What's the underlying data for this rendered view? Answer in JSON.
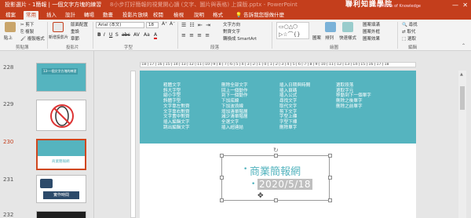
{
  "titlebar": {
    "left": "投影選片 - 1簡報 | 一個文字方塊的練習",
    "ghost": "8小步打好簡報的視覺開心讀 (文字、圖片與表格) 上課版.pptx - PowerPoint"
  },
  "brand": {
    "name": "聯利知識學院",
    "sub": "Institute of Knowledge"
  },
  "tabs": [
    "檔案",
    "常用",
    "插入",
    "設計",
    "轉場",
    "動畫",
    "投影片放映",
    "校閱",
    "檢視",
    "說明",
    "格式"
  ],
  "tellme": "告訴我您想做什麼",
  "ribbon": {
    "paste": "貼上",
    "cut": "剪下",
    "copy": "複製",
    "format_painter": "複製格式",
    "new_slide": "新增投影片",
    "layout": "版面配置",
    "reset": "重設",
    "section": "章節",
    "font_name": "Arial (本文)",
    "font_size": "18",
    "bold": "B",
    "italic": "I",
    "underline": "U",
    "strike": "S",
    "shadow": "abc",
    "spacing": "AV",
    "case": "Aa",
    "font_color": "A",
    "text_direction": "文字方向",
    "align_text": "對齊文字",
    "smartart": "轉換成 SmartArt",
    "shapes": "圖案",
    "arrange": "排列",
    "quick_styles": "快速樣式",
    "fill": "圖案填滿",
    "outline": "圖案外框",
    "effects": "圖案效果",
    "find": "尋找",
    "replace": "取代",
    "select": "選取",
    "groups": [
      "剪貼簿",
      "投影片",
      "字型",
      "段落",
      "繪圖",
      "編輯"
    ]
  },
  "ruler": "·18·|·17·|·16·|·15·|·14·|·13·|·12·|·11·|·10·|·9·|·8·|·7·|·6·|·5·|·4·|·3·|·2·|·1·|·0·|·1·|·2·|·3·|·4·|·5·|·6·|·7·|·8·|·9·|·10·|·11·|·12·|·13·|·14·|·15·|·16·|·17·|·18",
  "slides": [
    {
      "num": "228",
      "caption": "13-一個文字方塊的練習"
    },
    {
      "num": "229",
      "caption": ""
    },
    {
      "num": "230",
      "caption": "商業簡報網"
    },
    {
      "num": "231",
      "caption": "實作時間"
    },
    {
      "num": "232",
      "caption": ""
    }
  ],
  "slide": {
    "columns": [
      [
        "粗體文字",
        "斜大字型",
        "縮小字型",
        "斜體字型",
        "文字靠左對齊",
        "文字靠右對齊",
        "文字置中對齊",
        "插入編輯文字",
        "跳出編輯文字"
      ],
      [
        "刪除全部文字",
        "回上一個動作",
        "到下一個動作",
        "下加底線",
        "下加波浪線",
        "增加清單階層",
        "減少清單階層",
        "全選文字",
        "插入超連結"
      ],
      [
        "插入日期與時間",
        "插入頁碼",
        "插入公式",
        "尋找文字",
        "取代文字",
        "剪下文字",
        "字型上標",
        "字型下標",
        "刪除單字"
      ],
      [
        "選取段落",
        "選取字元",
        "移動到下一個單字",
        "刪除之後單字",
        "刪除之前單字"
      ]
    ],
    "title": "商業簡報網",
    "date": "2020/5/18"
  }
}
